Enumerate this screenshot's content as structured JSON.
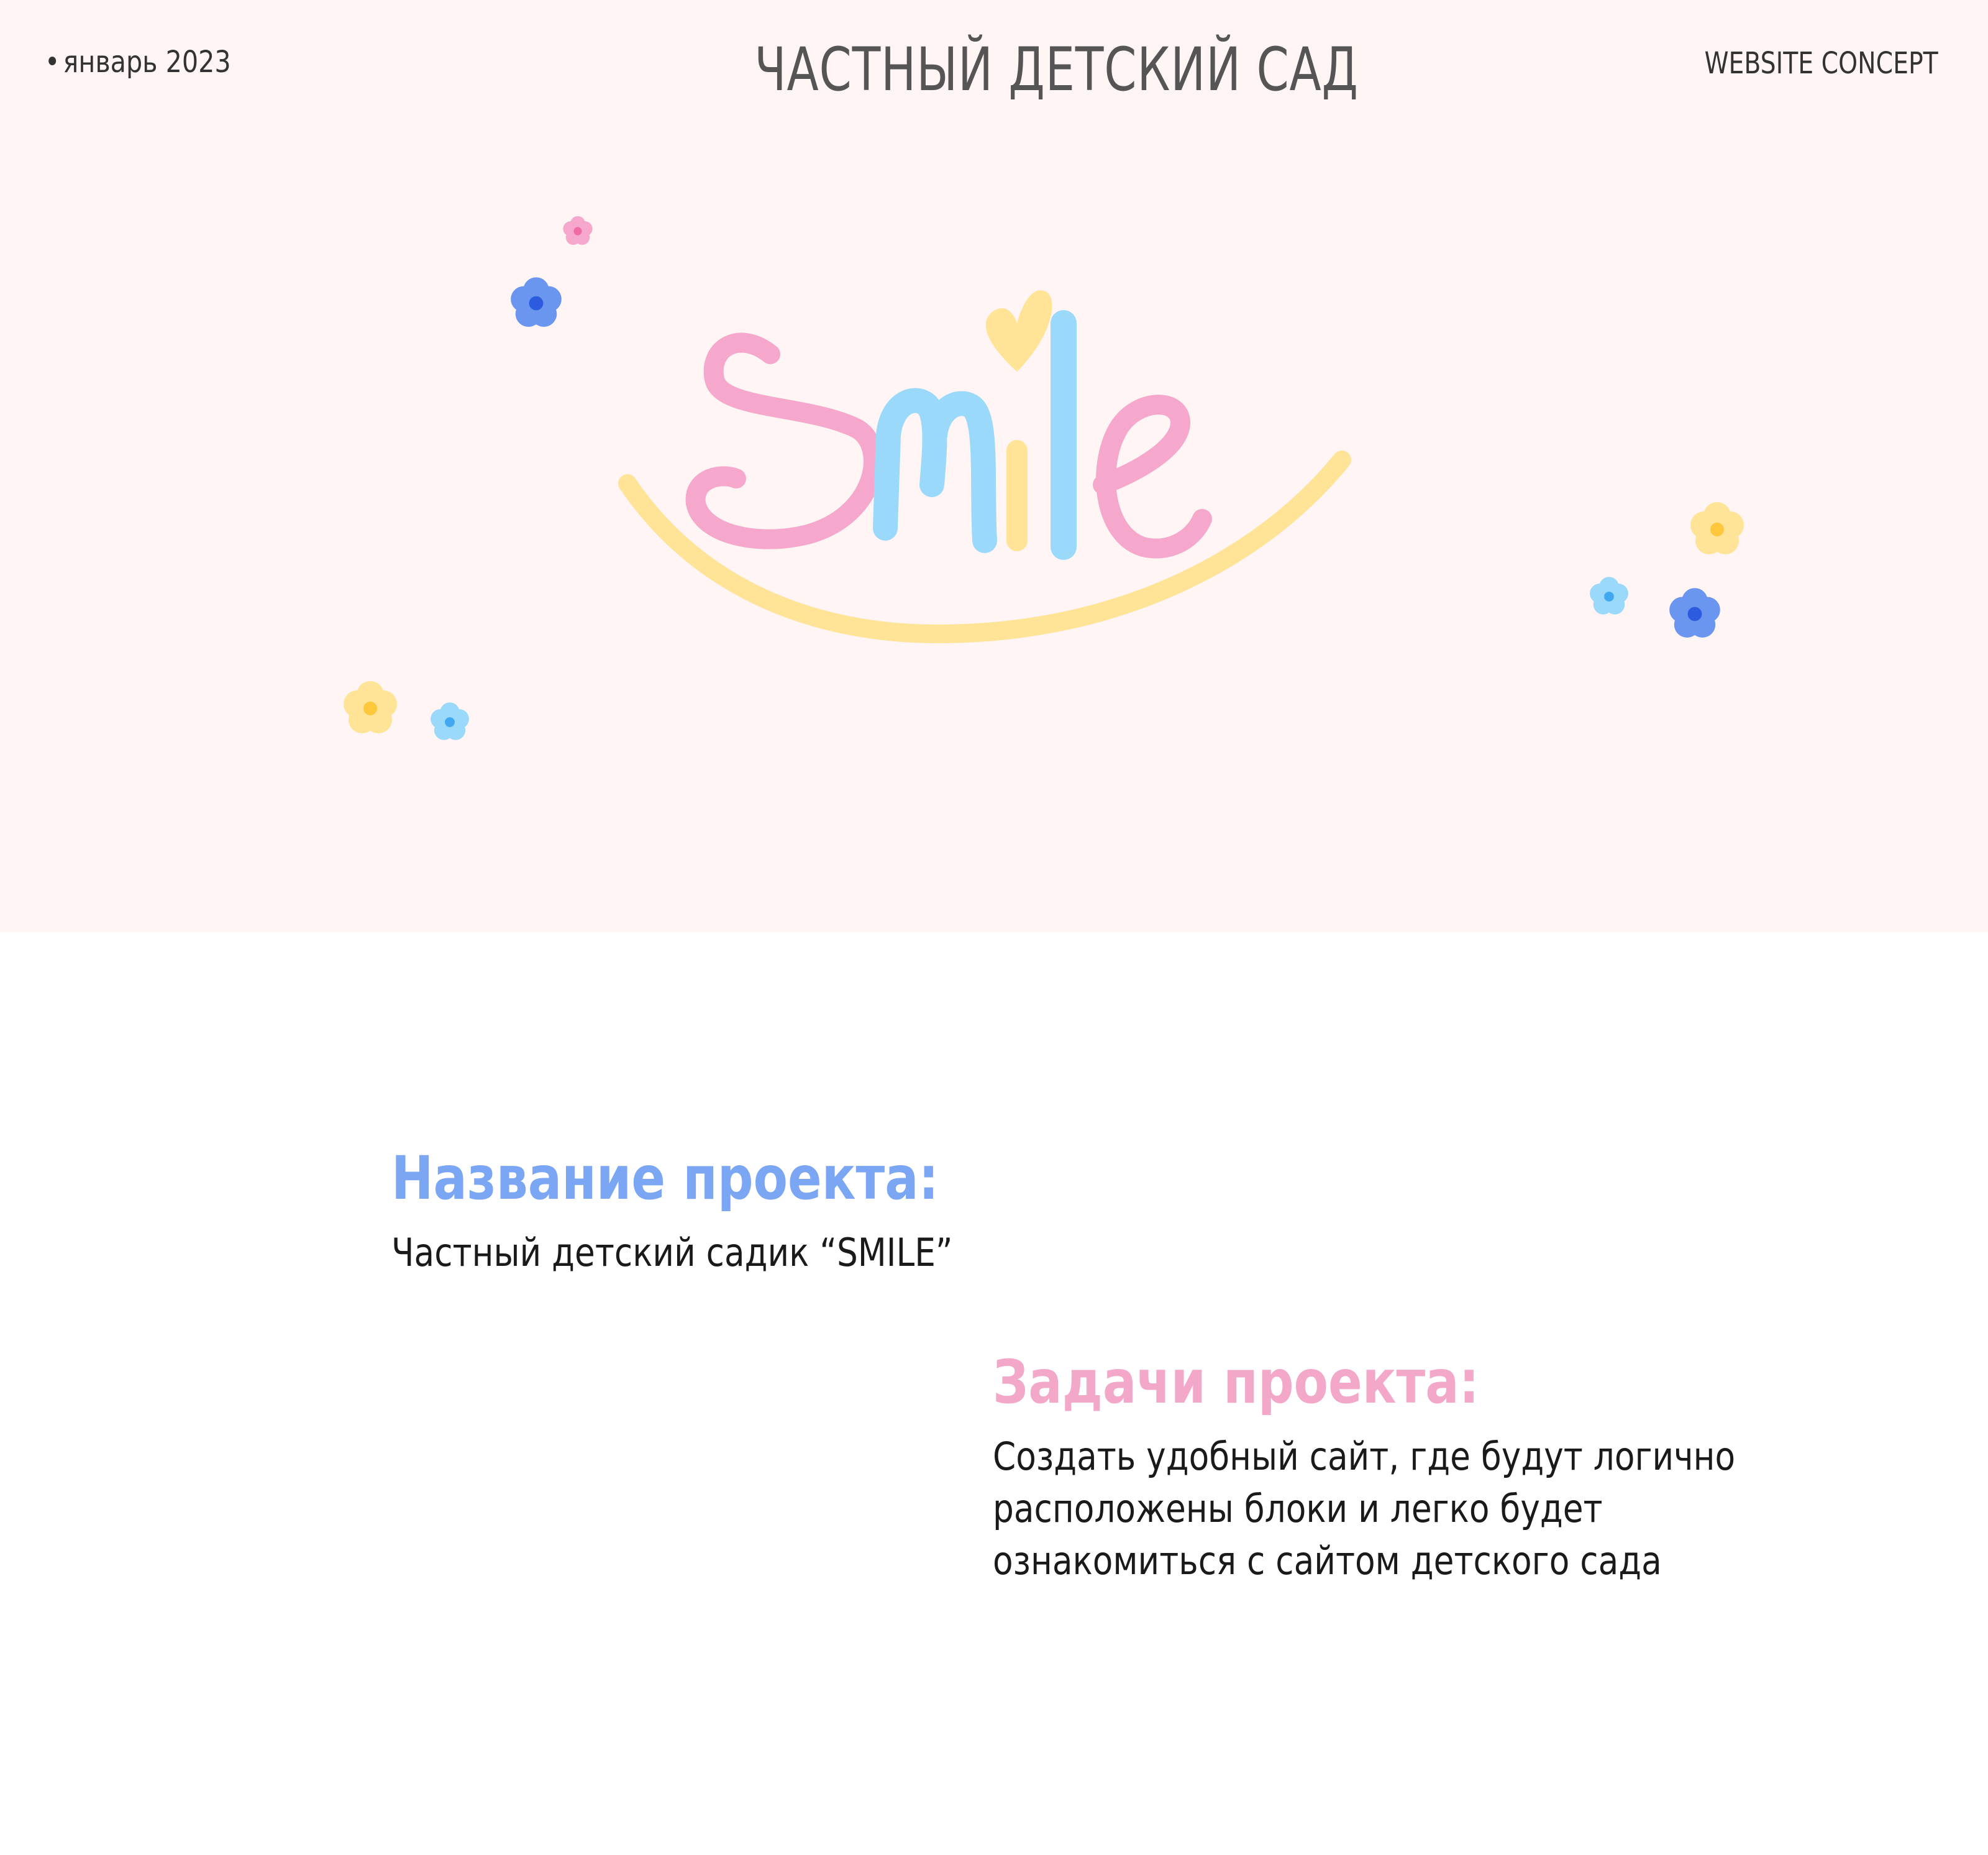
{
  "header": {
    "date_bullet": "•",
    "date": "январь 2023",
    "title": "ЧАСТНЫЙ ДЕТСКИЙ САД",
    "concept": "WEBSITE CONCEPT"
  },
  "logo": {
    "text": "Smile",
    "colors": {
      "pink": "#f5a8cb",
      "blue": "#9bd9fb",
      "yellow": "#ffe396",
      "dark_blue": "#6b96f0",
      "background": "#fff5f4"
    },
    "decorations": [
      "pink-flower-icon",
      "blue-flower-icon",
      "yellow-flower-icon",
      "light-blue-flower-icon",
      "heart-icon"
    ]
  },
  "project_name": {
    "heading": "Название проекта:",
    "text": "Частный детский садик “SMILE”"
  },
  "project_tasks": {
    "heading": "Задачи проекта:",
    "lines": [
      "Создать удобный сайт, где будут логично",
      "расположены блоки и легко будет",
      "ознакомиться с сайтом детского сада"
    ]
  }
}
